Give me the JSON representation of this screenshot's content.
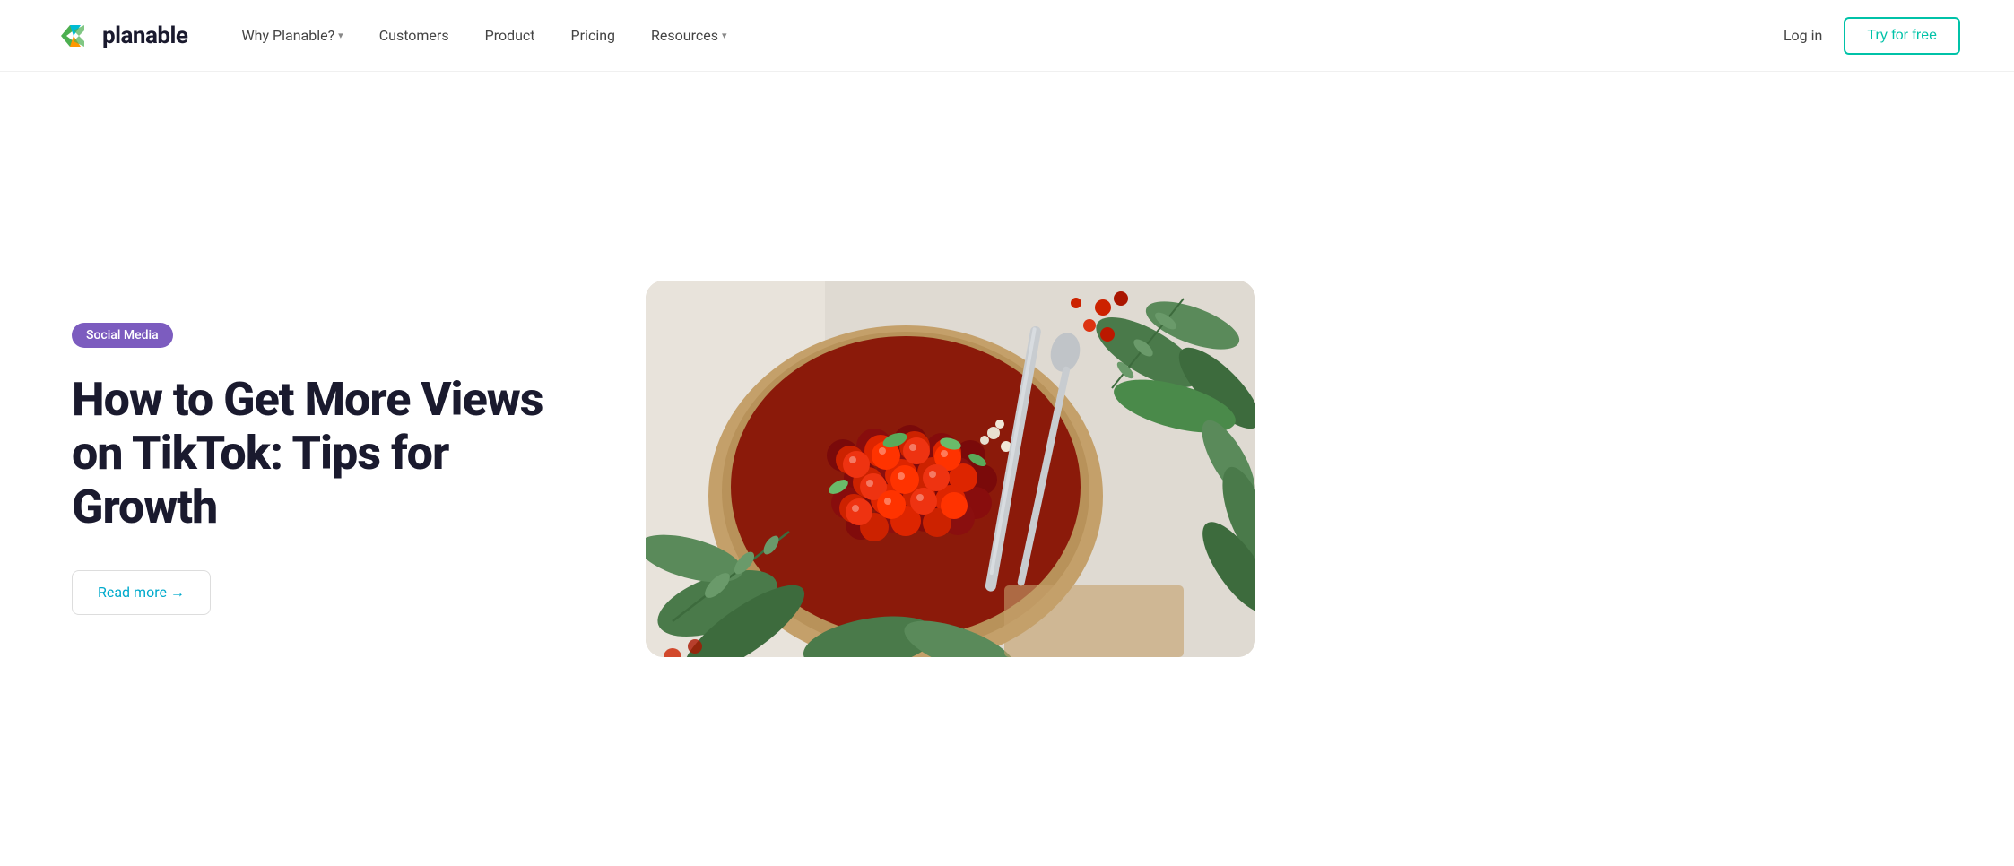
{
  "brand": {
    "name": "planable",
    "logo_alt": "Planable logo"
  },
  "nav": {
    "items": [
      {
        "label": "Why Planable?",
        "has_dropdown": true,
        "id": "why-planable"
      },
      {
        "label": "Customers",
        "has_dropdown": false,
        "id": "customers"
      },
      {
        "label": "Product",
        "has_dropdown": false,
        "id": "product"
      },
      {
        "label": "Pricing",
        "has_dropdown": false,
        "id": "pricing"
      },
      {
        "label": "Resources",
        "has_dropdown": true,
        "id": "resources"
      }
    ],
    "login_label": "Log in",
    "cta_label": "Try for free"
  },
  "hero": {
    "category_badge": "Social Media",
    "title": "How to Get More Views on TikTok: Tips for Growth",
    "read_more_label": "Read more →"
  },
  "colors": {
    "accent_teal": "#00c2a8",
    "accent_purple": "#7c5cbf",
    "text_dark": "#1a1a2e",
    "link_blue": "#00aacc"
  }
}
